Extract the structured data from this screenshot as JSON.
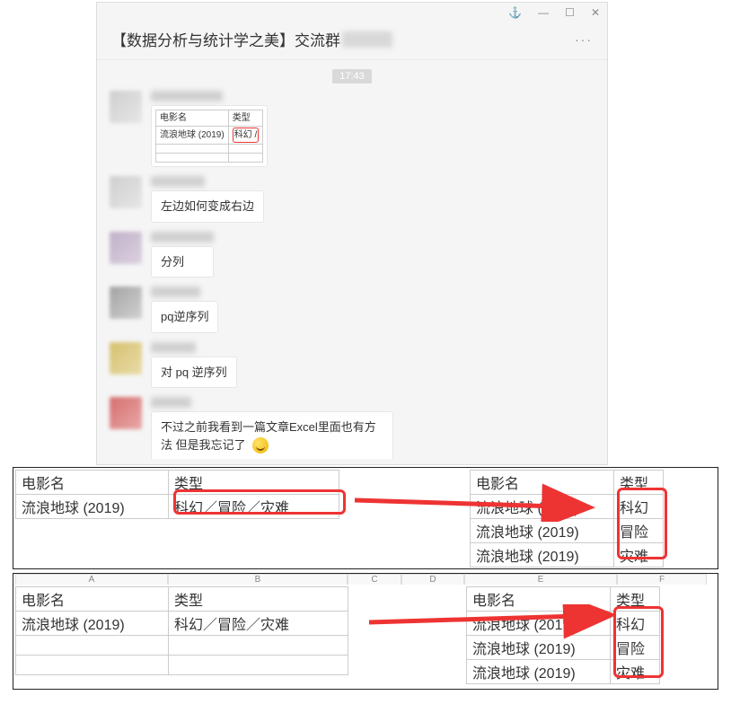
{
  "window": {
    "pin_icon": "⚓",
    "min_icon": "—",
    "max_icon": "☐",
    "close_icon": "✕"
  },
  "chat": {
    "title_prefix": "【数据分析与统计学之美】交流群",
    "more": "···",
    "timestamp": "17:43",
    "mini_table": {
      "h1": "电影名",
      "h2": "类型",
      "r1c1": "流浪地球 (2019)",
      "r1c2": "科幻 /"
    },
    "messages": {
      "m1": "左边如何变成右边",
      "m2": "分列",
      "m3": "pq逆序列",
      "m4": "对 pq 逆序列",
      "m5": "不过之前我看到一篇文章Excel里面也有方法 但是我忘记了"
    }
  },
  "tables": {
    "h_movie": "电影名",
    "h_type": "类型",
    "movie": "流浪地球 (2019)",
    "type_combined": "科幻／冒险／灾难",
    "type1": "科幻",
    "type2": "冒险",
    "type3": "灾难",
    "colA": "A",
    "colB": "B",
    "colC": "C",
    "colD": "D",
    "colE": "E",
    "colF": "F"
  }
}
